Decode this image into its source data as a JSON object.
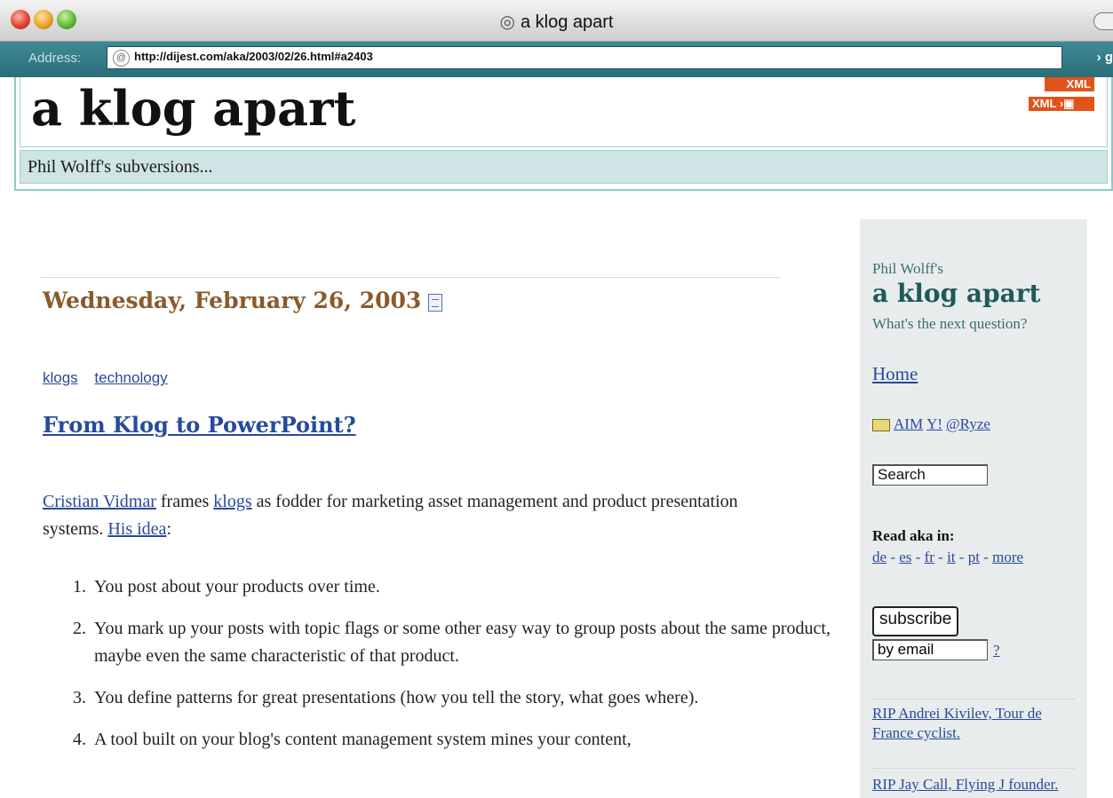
{
  "window": {
    "title": "a klog apart"
  },
  "address_bar": {
    "label": "Address:",
    "url": "http://dijest.com/aka/2003/02/26.html#a2403",
    "go_label": "g"
  },
  "header": {
    "site_title": "a klog apart",
    "tagline": "Phil Wolff's subversions...",
    "xml_badge_1": "XML",
    "xml_badge_2": "XML"
  },
  "post": {
    "date": "Wednesday, February 26, 2003",
    "topics": [
      "klogs",
      "technology"
    ],
    "title": "From Klog to PowerPoint?",
    "intro": {
      "link_author": "Cristian Vidmar",
      "text_1": " frames ",
      "link_klogs": "klogs",
      "text_2": " as fodder for marketing asset management and product presentation systems. ",
      "link_idea": "His idea",
      "text_3": ":"
    },
    "steps": [
      "You post about your products over time.",
      "You mark up your posts with topic flags or some other easy way to group posts about the same product, maybe even the same characteristic of that product.",
      "You define patterns for great presentations (how you tell the story, what goes where).",
      "A tool built on your blog's content management system mines your content,"
    ]
  },
  "sidebar": {
    "owner": "Phil Wolff's",
    "title": "a klog apart",
    "question": "What's the next question?",
    "home": "Home",
    "im_links": [
      "AIM",
      "Y!",
      "@Ryze"
    ],
    "search_value": "Search",
    "read_in_label": "Read aka in:",
    "languages": [
      "de",
      "es",
      "fr",
      "it",
      "pt",
      "more"
    ],
    "subscribe_label": "subscribe",
    "email_value": "by email",
    "help_label": "?",
    "news_links": [
      "RIP Andrei Kivilev, Tour de France cyclist.",
      "RIP Jay Call, Flying J founder."
    ]
  }
}
